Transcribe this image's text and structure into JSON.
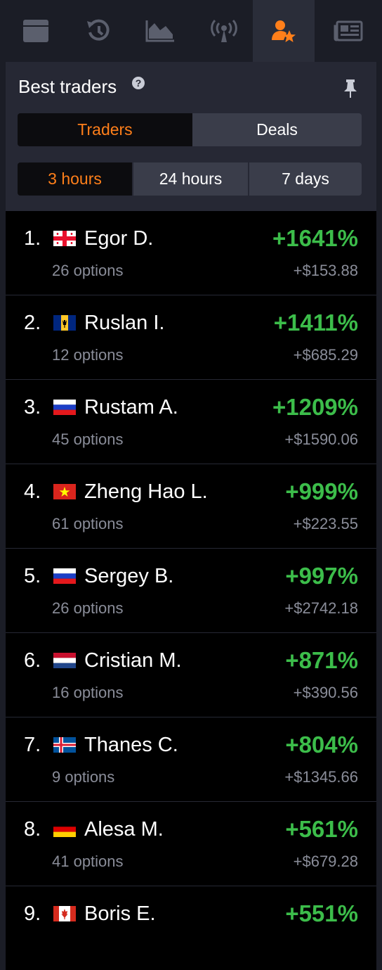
{
  "topbar": {
    "tabs": [
      {
        "icon": "window-icon",
        "active": false
      },
      {
        "icon": "history-icon",
        "active": false
      },
      {
        "icon": "chart-area-icon",
        "active": false
      },
      {
        "icon": "broadcast-icon",
        "active": false
      },
      {
        "icon": "user-star-icon",
        "active": true
      },
      {
        "icon": "newspaper-icon",
        "active": false
      }
    ]
  },
  "panel": {
    "title": "Best traders",
    "help": "?",
    "mode_tabs": [
      {
        "label": "Traders",
        "active": true
      },
      {
        "label": "Deals",
        "active": false
      }
    ],
    "period_tabs": [
      {
        "label": "3 hours",
        "active": true
      },
      {
        "label": "24 hours",
        "active": false
      },
      {
        "label": "7 days",
        "active": false
      }
    ]
  },
  "traders": [
    {
      "rank": "1.",
      "flag": "georgia-flag",
      "name": "Egor D.",
      "options": "26 options",
      "pct": "+1641%",
      "profit": "+$153.88"
    },
    {
      "rank": "2.",
      "flag": "barbados-flag",
      "name": "Ruslan I.",
      "options": "12 options",
      "pct": "+1411%",
      "profit": "+$685.29"
    },
    {
      "rank": "3.",
      "flag": "russia-flag",
      "name": "Rustam A.",
      "options": "45 options",
      "pct": "+1209%",
      "profit": "+$1590.06"
    },
    {
      "rank": "4.",
      "flag": "vietnam-flag",
      "name": "Zheng Hao L.",
      "options": "61 options",
      "pct": "+999%",
      "profit": "+$223.55"
    },
    {
      "rank": "5.",
      "flag": "russia-flag",
      "name": "Sergey B.",
      "options": "26 options",
      "pct": "+997%",
      "profit": "+$2742.18"
    },
    {
      "rank": "6.",
      "flag": "netherlands-flag",
      "name": "Cristian M.",
      "options": "16 options",
      "pct": "+871%",
      "profit": "+$390.56"
    },
    {
      "rank": "7.",
      "flag": "iceland-flag",
      "name": "Thanes C.",
      "options": "9 options",
      "pct": "+804%",
      "profit": "+$1345.66"
    },
    {
      "rank": "8.",
      "flag": "germany-flag",
      "name": "Alesa M.",
      "options": "41 options",
      "pct": "+561%",
      "profit": "+$679.28"
    },
    {
      "rank": "9.",
      "flag": "canada-flag",
      "name": "Boris E.",
      "options": "",
      "pct": "+551%",
      "profit": ""
    }
  ],
  "colors": {
    "accent": "#ff7f1a",
    "positive": "#3cbd4a",
    "muted": "#8a8d99",
    "panel_bg": "#262834",
    "top_bg": "#1b1d26"
  }
}
